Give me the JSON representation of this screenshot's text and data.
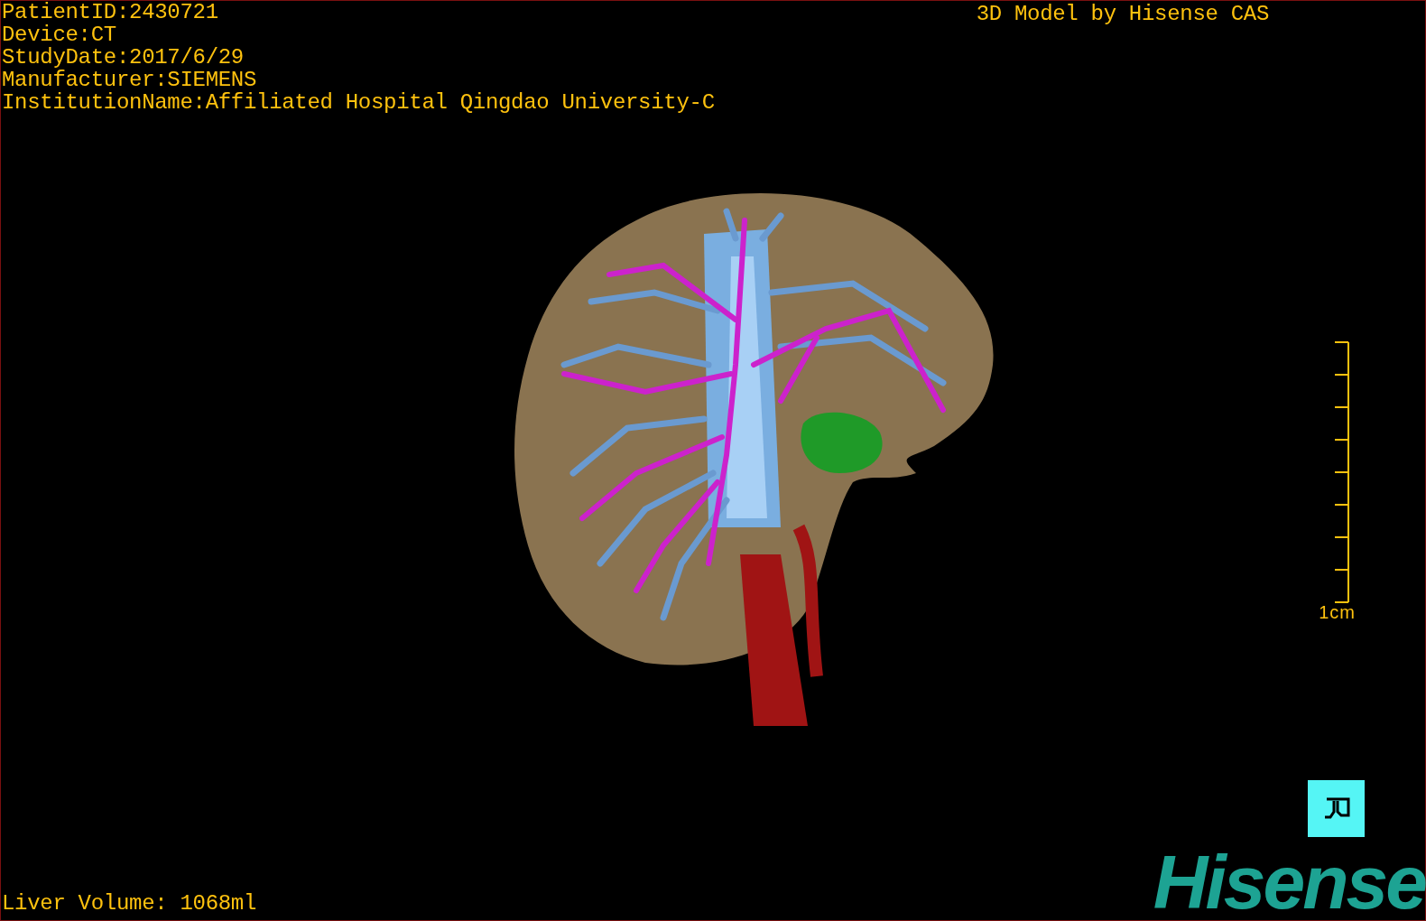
{
  "study_info": [
    "PatientID:2430721",
    "Device:CT",
    "StudyDate:2017/6/29",
    "Manufacturer:SIEMENS",
    "InstitutionName:Affiliated Hospital Qingdao University-C"
  ],
  "model_title": "3D Model by Hisense CAS",
  "scale_bar": {
    "label": "1cm"
  },
  "liver_volume": "Liver Volume: 1068ml",
  "logo": "Hisense"
}
